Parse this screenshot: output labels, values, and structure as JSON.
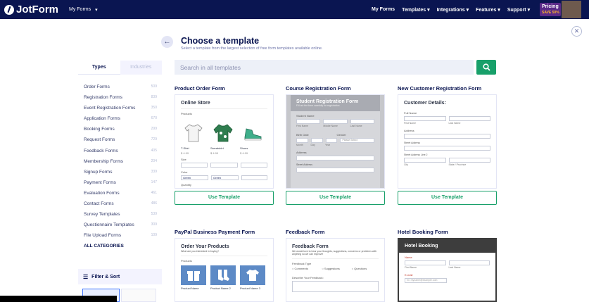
{
  "topbar": {
    "brand": "JotForm",
    "my_forms": "My Forms",
    "nav": [
      "My Forms",
      "Templates ▾",
      "Integrations ▾",
      "Features ▾",
      "Support ▾"
    ],
    "pricing": "Pricing",
    "pricing_promo": "SAVE 50%"
  },
  "modal": {
    "title": "Choose a template",
    "subtitle": "Select a template from the largest selection of free form templates available online.",
    "tabs": [
      "Types",
      "Industries"
    ],
    "search_placeholder": "Search in all templates",
    "categories": [
      {
        "label": "Order Forms",
        "count": "509"
      },
      {
        "label": "Registration Forms",
        "count": "839"
      },
      {
        "label": "Event Registration Forms",
        "count": "350"
      },
      {
        "label": "Application Forms",
        "count": "670"
      },
      {
        "label": "Booking Forms",
        "count": "299"
      },
      {
        "label": "Request Forms",
        "count": "729"
      },
      {
        "label": "Feedback Forms",
        "count": "405"
      },
      {
        "label": "Membership Forms",
        "count": "204"
      },
      {
        "label": "Signup Forms",
        "count": "339"
      },
      {
        "label": "Payment Forms",
        "count": "147"
      },
      {
        "label": "Evaluation Forms",
        "count": "461"
      },
      {
        "label": "Contact Forms",
        "count": "486"
      },
      {
        "label": "Survey Templates",
        "count": "539"
      },
      {
        "label": "Questionnaire Templates",
        "count": "309"
      },
      {
        "label": "File Upload Forms",
        "count": "109"
      }
    ],
    "all_categories": "ALL CATEGORIES",
    "filter_sort": "Filter & Sort",
    "use_template": "Use Template"
  },
  "templates": [
    {
      "name": "Product Order Form",
      "preview_title": "Online Store",
      "products_label": "Products",
      "products": [
        "T-Shirt",
        "Sweatshirt",
        "Shoes"
      ],
      "prices": [
        "$ 4.99",
        "$ 4.99",
        "$ 4.99"
      ],
      "size_label": "Size",
      "color_label": "Color",
      "color_value": "Green",
      "quantity_label": "Quantity",
      "quantity_value": "3"
    },
    {
      "name": "Course Registration Form",
      "preview_title": "Student Registration Form",
      "preview_sub": "Fill out the form carefully for registration",
      "fields": [
        "Student Name",
        "First Name",
        "Middle Name",
        "Last Name",
        "Birth Date",
        "Gender",
        "Please Select",
        "Month",
        "Day",
        "Year",
        "Address",
        "Street Address"
      ]
    },
    {
      "name": "New Customer Registration Form",
      "preview_title": "Customer Details:",
      "fields": [
        "Full Name",
        "First Name",
        "Last Name",
        "Address",
        "Street Address",
        "Street Address Line 2",
        "City",
        "State / Province"
      ]
    },
    {
      "name": "PayPal Business Payment Form",
      "preview_title": "Order Your Products",
      "preview_sub": "What are you interested in buying?",
      "products_label": "Products",
      "product_names": [
        "Product Name",
        "Product Name 2",
        "Product Name 3"
      ]
    },
    {
      "name": "Feedback Form",
      "preview_title": "Feedback Form",
      "preview_sub": "We would love to hear your thoughts, suggestions, concerns or problems with anything so we can improve!",
      "type_label": "Feedback Type",
      "options": [
        "Comments",
        "Suggestions",
        "Questions"
      ],
      "describe_label": "Describe Your Feedback:"
    },
    {
      "name": "Hotel Booking Form",
      "preview_title": "Hotel Booking",
      "fields": [
        "Name",
        "First Name",
        "Last Name",
        "E-mail",
        "ex: myname@example.com"
      ]
    }
  ]
}
